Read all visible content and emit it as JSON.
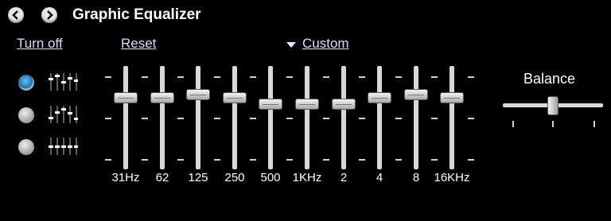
{
  "header": {
    "title": "Graphic Equalizer",
    "back_icon": "chevron-left-icon",
    "forward_icon": "chevron-right-icon"
  },
  "controls": {
    "turn_off_label": "Turn off",
    "reset_label": "Reset",
    "preset_label": "Custom"
  },
  "presets": [
    {
      "icon": "preset-custom-icon",
      "selected": true
    },
    {
      "icon": "preset-curve-icon",
      "selected": false
    },
    {
      "icon": "preset-flat-icon",
      "selected": false
    }
  ],
  "bands": [
    {
      "label": "31Hz",
      "level": 0.31
    },
    {
      "label": "62",
      "level": 0.31
    },
    {
      "label": "125",
      "level": 0.28
    },
    {
      "label": "250",
      "level": 0.31
    },
    {
      "label": "500",
      "level": 0.37
    },
    {
      "label": "1KHz",
      "level": 0.37
    },
    {
      "label": "2",
      "level": 0.37
    },
    {
      "label": "4",
      "level": 0.31
    },
    {
      "label": "8",
      "level": 0.28
    },
    {
      "label": "16KHz",
      "level": 0.31
    }
  ],
  "balance": {
    "label": "Balance",
    "value": 0.5
  },
  "colors": {
    "background": "#000000",
    "link": "#cfe0ff",
    "selected_radio": "#1f6fa8"
  }
}
